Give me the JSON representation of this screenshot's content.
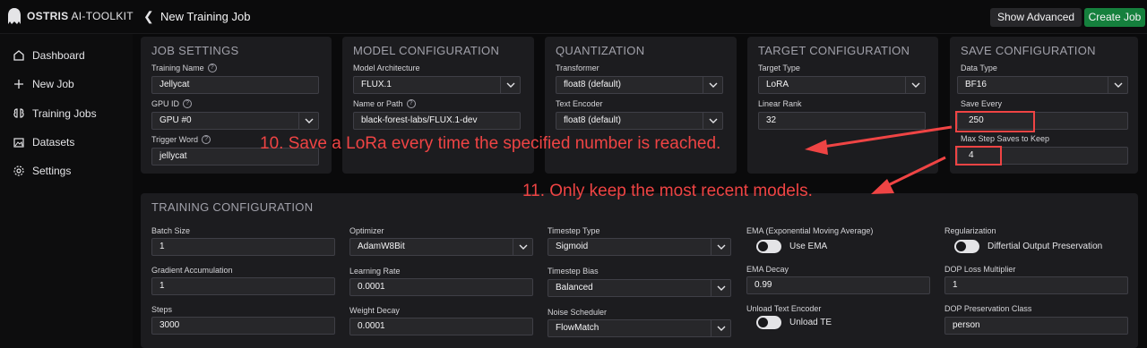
{
  "app": {
    "logo_bold": "OSTRIS",
    "logo_rest": " AI-TOOLKIT",
    "page_title": "New Training Job"
  },
  "toolbar": {
    "show_advanced": "Show Advanced",
    "create_job": "Create Job"
  },
  "sidebar": {
    "items": [
      {
        "label": "Dashboard",
        "icon": "home-icon"
      },
      {
        "label": "New Job",
        "icon": "plus-icon"
      },
      {
        "label": "Training Jobs",
        "icon": "brain-icon"
      },
      {
        "label": "Datasets",
        "icon": "images-icon"
      },
      {
        "label": "Settings",
        "icon": "gear-icon"
      }
    ]
  },
  "job": {
    "title": "JOB SETTINGS",
    "name_label": "Training Name",
    "name_value": "Jellycat",
    "gpu_label": "GPU ID",
    "gpu_value": "GPU #0",
    "trigger_label": "Trigger Word",
    "trigger_value": "jellycat"
  },
  "model": {
    "title": "MODEL CONFIGURATION",
    "arch_label": "Model Architecture",
    "arch_value": "FLUX.1",
    "path_label": "Name or Path",
    "path_value": "black-forest-labs/FLUX.1-dev"
  },
  "quant": {
    "title": "QUANTIZATION",
    "transformer_label": "Transformer",
    "transformer_value": "float8 (default)",
    "te_label": "Text Encoder",
    "te_value": "float8 (default)"
  },
  "target": {
    "title": "TARGET CONFIGURATION",
    "type_label": "Target Type",
    "type_value": "LoRA",
    "rank_label": "Linear Rank",
    "rank_value": "32"
  },
  "save": {
    "title": "SAVE CONFIGURATION",
    "dtype_label": "Data Type",
    "dtype_value": "BF16",
    "every_label": "Save Every",
    "every_value": "250",
    "max_label": "Max Step Saves to Keep",
    "max_value": "4"
  },
  "training": {
    "title": "TRAINING CONFIGURATION",
    "batch_label": "Batch Size",
    "batch_value": "1",
    "grad_label": "Gradient Accumulation",
    "grad_value": "1",
    "steps_label": "Steps",
    "steps_value": "3000",
    "opt_label": "Optimizer",
    "opt_value": "AdamW8Bit",
    "lr_label": "Learning Rate",
    "lr_value": "0.0001",
    "wd_label": "Weight Decay",
    "wd_value": "0.0001",
    "ts_type_label": "Timestep Type",
    "ts_type_value": "Sigmoid",
    "ts_bias_label": "Timestep Bias",
    "ts_bias_value": "Balanced",
    "noise_label": "Noise Scheduler",
    "noise_value": "FlowMatch",
    "ema_label": "EMA (Exponential Moving Average)",
    "ema_toggle": "Use EMA",
    "ema_decay_label": "EMA Decay",
    "ema_decay_value": "0.99",
    "unload_label": "Unload Text Encoder",
    "unload_toggle": "Unload TE",
    "reg_label": "Regularization",
    "reg_toggle": "Differtial Output Preservation",
    "dop_mult_label": "DOP Loss Multiplier",
    "dop_mult_value": "1",
    "dop_class_label": "DOP Preservation Class",
    "dop_class_value": "person"
  },
  "annotations": {
    "a10": "10. Save a LoRa every time the specified number is reached.",
    "a11": "11. Only keep the most recent models.",
    "color": "#ef4444"
  }
}
